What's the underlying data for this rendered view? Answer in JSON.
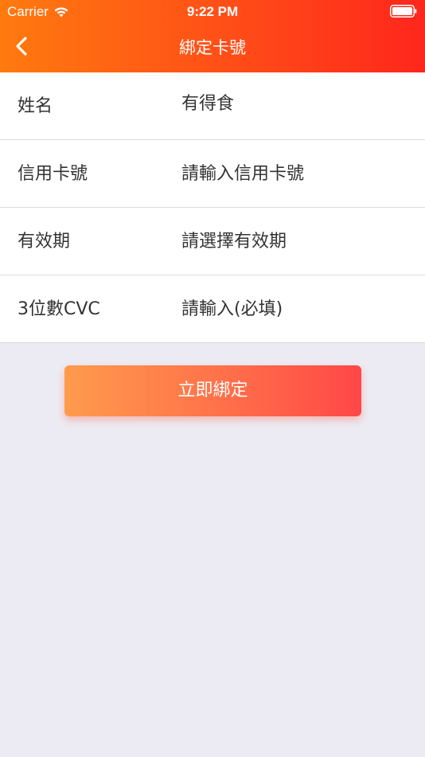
{
  "status_bar": {
    "carrier": "Carrier",
    "time": "9:22 PM",
    "wifi_icon": "wifi-icon",
    "battery_icon": "battery-icon"
  },
  "nav": {
    "title": "綁定卡號",
    "back_icon": "chevron-left-icon"
  },
  "form": {
    "rows": [
      {
        "label": "姓名",
        "value": "有得食"
      },
      {
        "label": "信用卡號",
        "value": "請輸入信用卡號"
      },
      {
        "label": "有效期",
        "value": "請選擇有效期"
      },
      {
        "label": "3位數CVC",
        "value": "請輸入(必填)"
      }
    ]
  },
  "button": {
    "label": "立即綁定"
  },
  "colors": {
    "header_start": "#ff7a0f",
    "header_end": "#ff261c",
    "button_start": "#ff9b4d",
    "button_end": "#ff4747",
    "background": "#ecebf3"
  }
}
